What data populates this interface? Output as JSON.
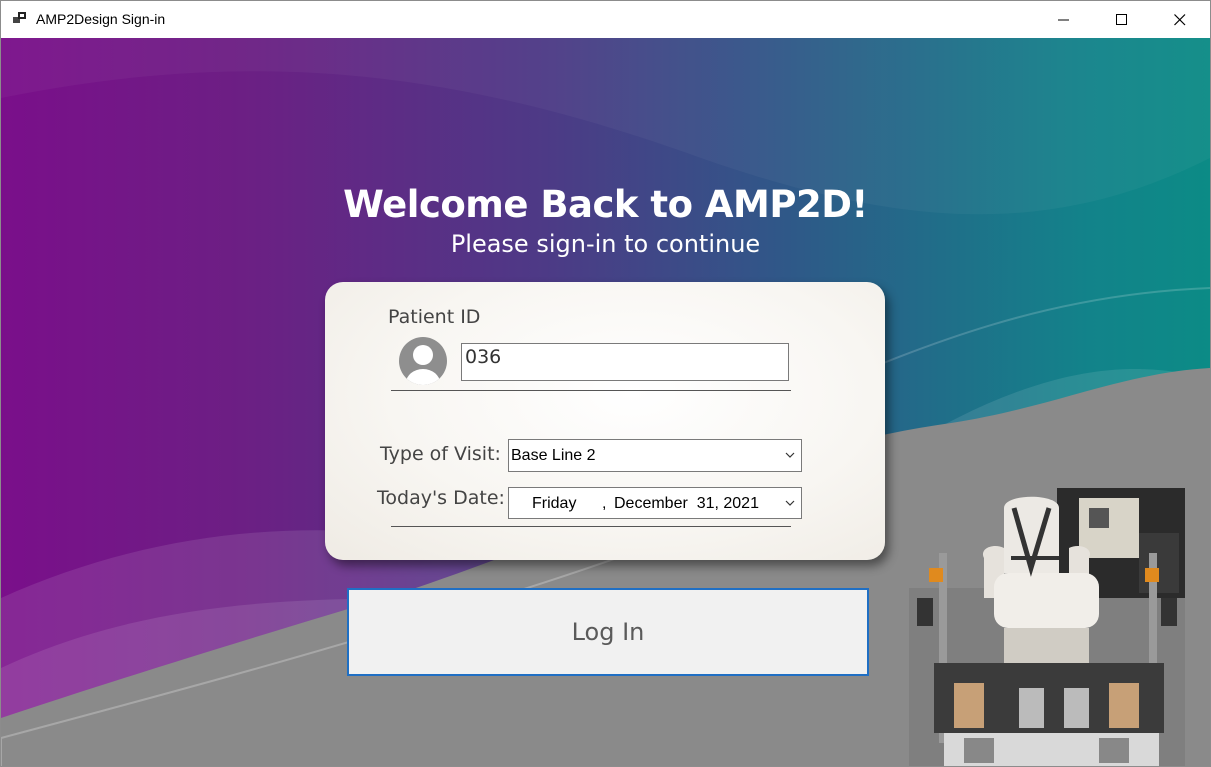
{
  "window": {
    "title": "AMP2Design Sign-in",
    "controls": {
      "minimize": "minimize",
      "maximize": "maximize",
      "close": "close"
    }
  },
  "heading": {
    "welcome": "Welcome Back to AMP2D!",
    "subtitle": "Please sign-in to continue"
  },
  "form": {
    "patient_id_label": "Patient ID",
    "patient_id_value": "036",
    "visit_label": "Type of Visit:",
    "visit_value": "Base Line 2",
    "date_label": "Today's Date:",
    "date_weekday": "Friday",
    "date_sep": ",",
    "date_month_day": "December  31, 2021"
  },
  "login_button": "Log In",
  "icons": [
    "app-icon",
    "minimize-icon",
    "maximize-icon",
    "close-icon",
    "user-avatar-icon",
    "chevron-down-icon"
  ],
  "colors": {
    "gradient_left": "#7a0f8a",
    "gradient_right": "#0c8b86",
    "login_border": "#1f6fc4",
    "card_bg": "#f8f6f2"
  }
}
